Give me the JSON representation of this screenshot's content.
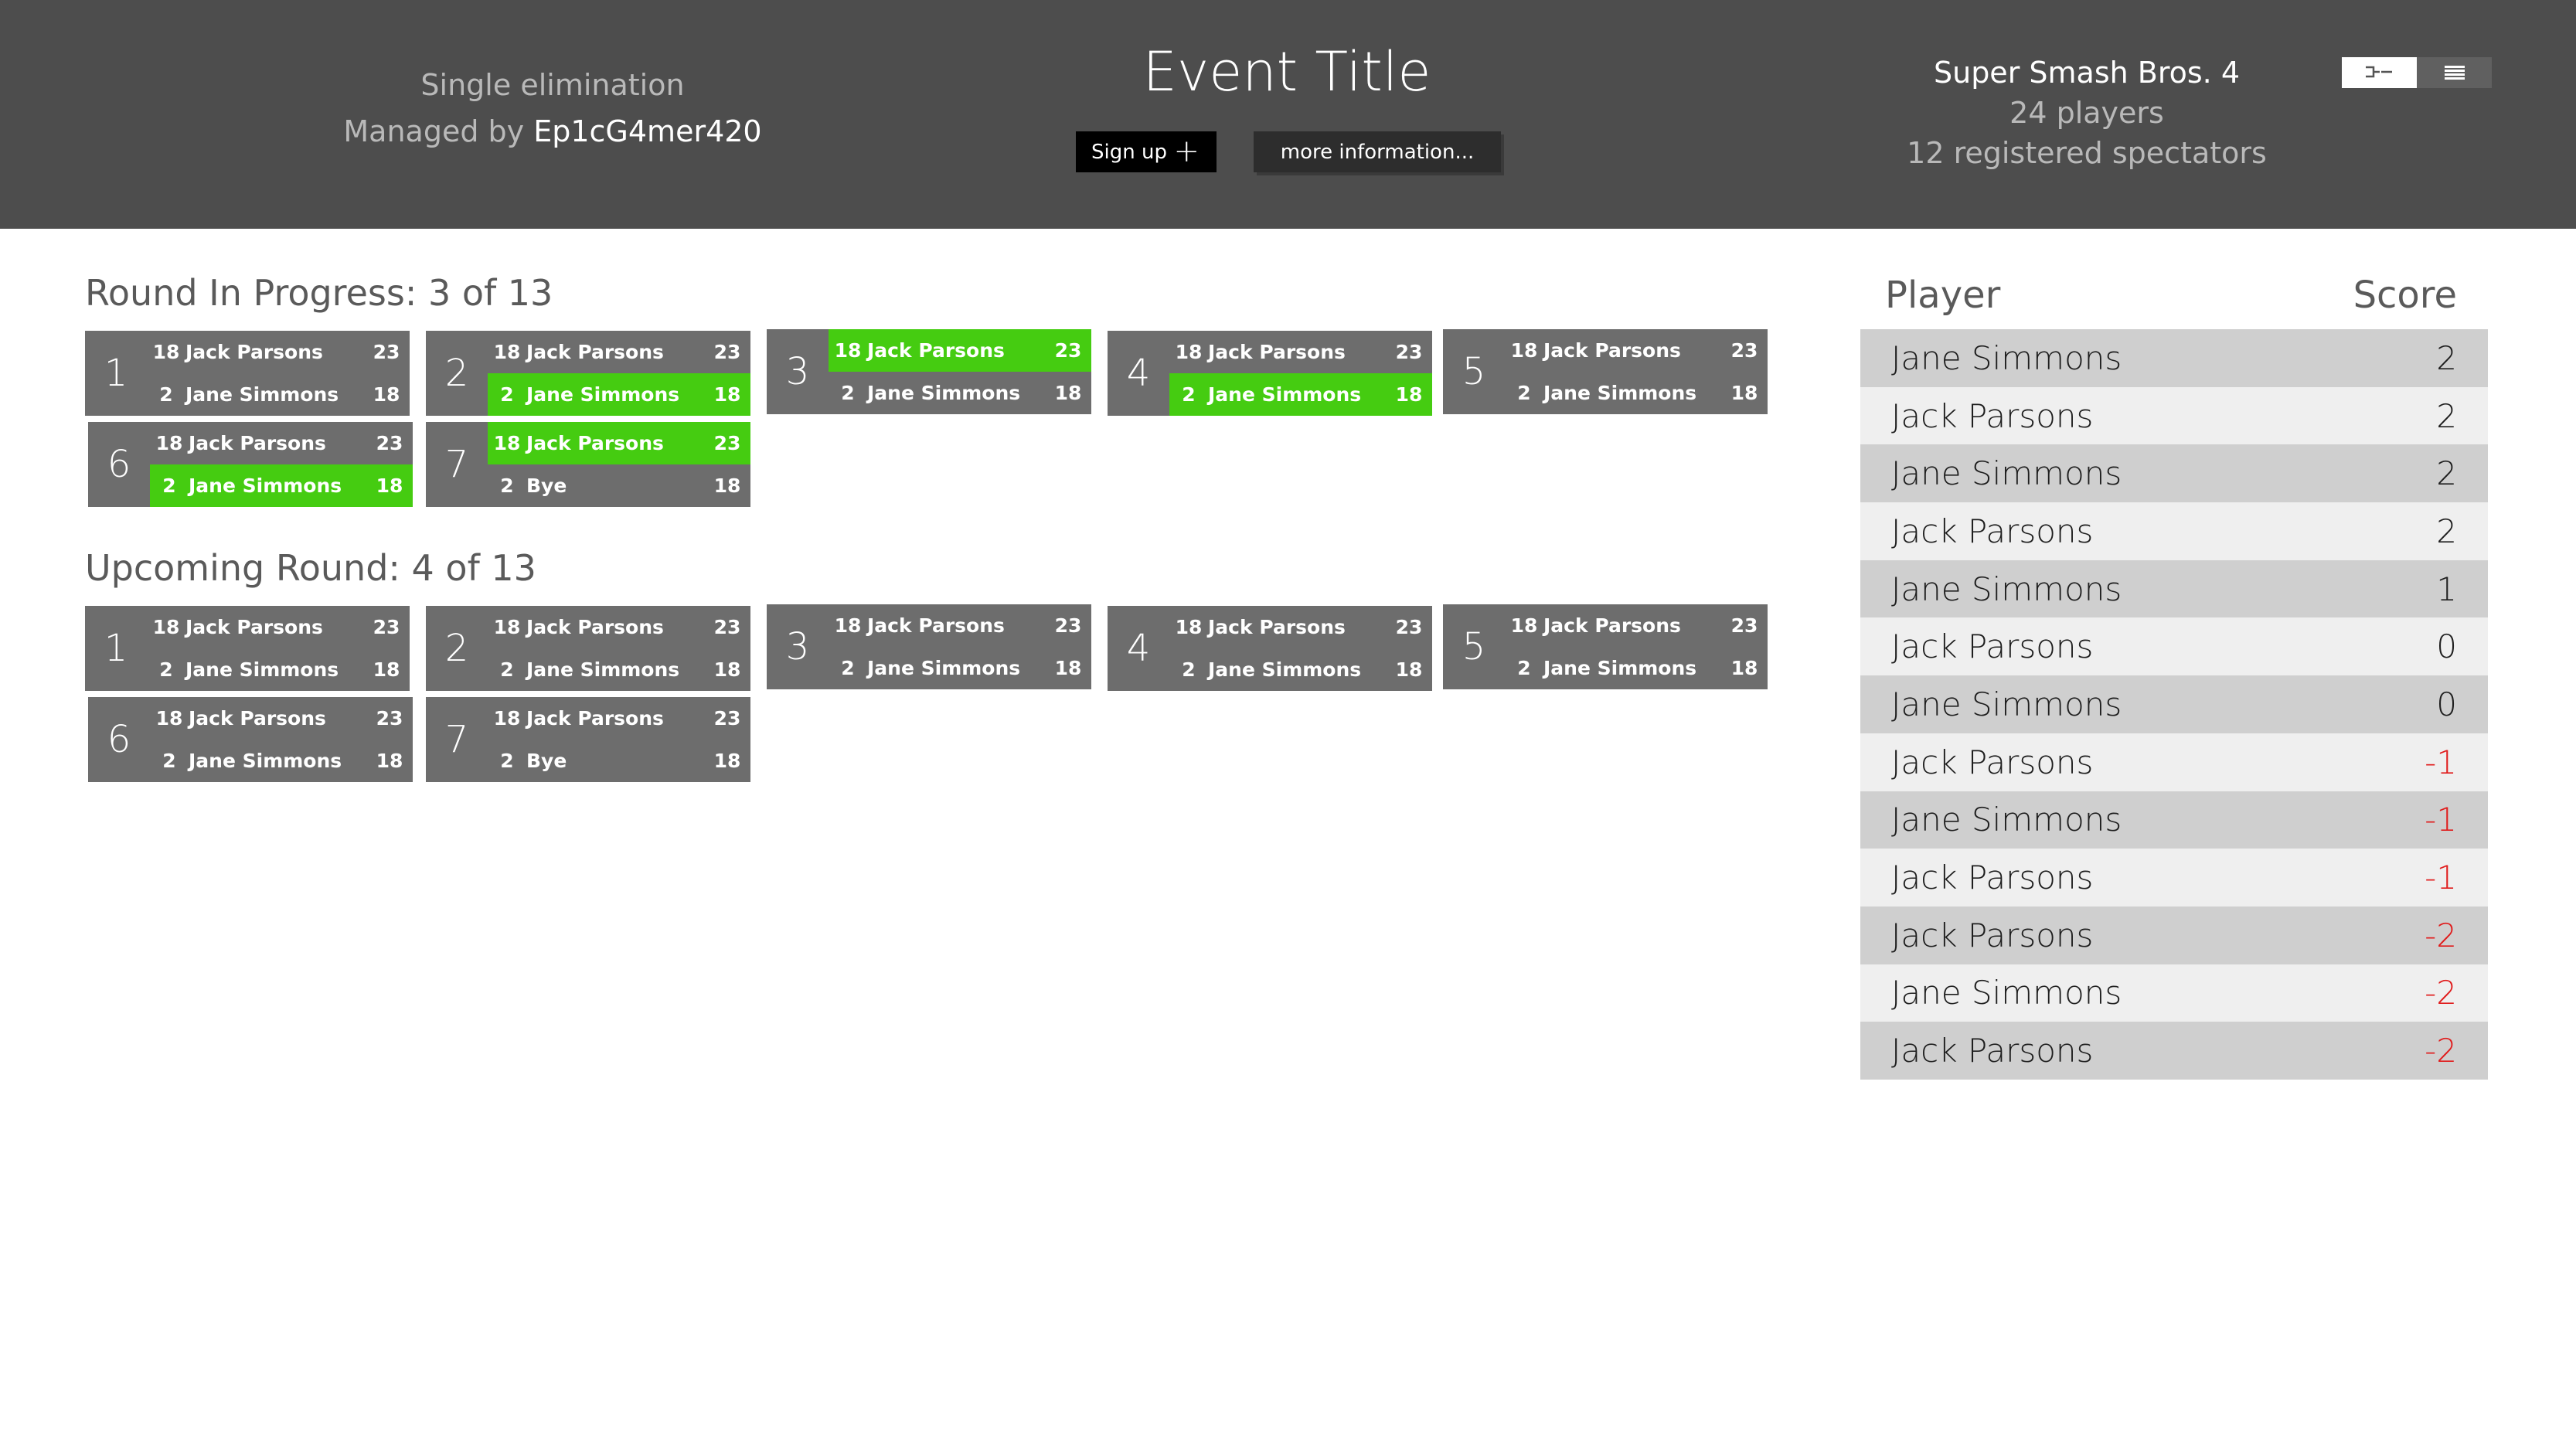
{
  "header": {
    "format": "Single elimination",
    "managed_by_label": "Managed by",
    "manager": "Ep1cG4mer420",
    "title": "Event Title",
    "signup_label": "Sign up",
    "signup_icon": "plus-icon",
    "info_label": "more information...",
    "game": "Super Smash Bros. 4",
    "players": "24 players",
    "spectators": "12 registered spectators",
    "view_toggle": [
      "bracket-view-icon",
      "list-view-icon"
    ]
  },
  "colors": {
    "header_bg": "#4d4d4d",
    "card_bg": "#6d6d6d",
    "winner": "#45cc11",
    "negative": "#e01b1b"
  },
  "current_round": {
    "title": "Round In Progress: 3 of 13",
    "matches": [
      {
        "num": "1",
        "p1": {
          "seed": "18",
          "name": "Jack Parsons",
          "score": "23"
        },
        "p2": {
          "seed": "2",
          "name": "Jane Simmons",
          "score": "18"
        },
        "winner": ""
      },
      {
        "num": "2",
        "p1": {
          "seed": "18",
          "name": "Jack Parsons",
          "score": "23"
        },
        "p2": {
          "seed": "2",
          "name": "Jane Simmons",
          "score": "18"
        },
        "winner": "p2"
      },
      {
        "num": "3",
        "p1": {
          "seed": "18",
          "name": "Jack Parsons",
          "score": "23"
        },
        "p2": {
          "seed": "2",
          "name": "Jane Simmons",
          "score": "18"
        },
        "winner": "p1"
      },
      {
        "num": "4",
        "p1": {
          "seed": "18",
          "name": "Jack Parsons",
          "score": "23"
        },
        "p2": {
          "seed": "2",
          "name": "Jane Simmons",
          "score": "18"
        },
        "winner": "p2"
      },
      {
        "num": "5",
        "p1": {
          "seed": "18",
          "name": "Jack Parsons",
          "score": "23"
        },
        "p2": {
          "seed": "2",
          "name": "Jane Simmons",
          "score": "18"
        },
        "winner": ""
      },
      {
        "num": "6",
        "p1": {
          "seed": "18",
          "name": "Jack Parsons",
          "score": "23"
        },
        "p2": {
          "seed": "2",
          "name": "Jane Simmons",
          "score": "18"
        },
        "winner": "p2"
      },
      {
        "num": "7",
        "p1": {
          "seed": "18",
          "name": "Jack Parsons",
          "score": "23"
        },
        "p2": {
          "seed": "2",
          "name": "Bye",
          "score": "18"
        },
        "winner": "p1"
      }
    ]
  },
  "upcoming_round": {
    "title": "Upcoming Round: 4 of 13",
    "matches": [
      {
        "num": "1",
        "p1": {
          "seed": "18",
          "name": "Jack Parsons",
          "score": "23"
        },
        "p2": {
          "seed": "2",
          "name": "Jane Simmons",
          "score": "18"
        },
        "winner": ""
      },
      {
        "num": "2",
        "p1": {
          "seed": "18",
          "name": "Jack Parsons",
          "score": "23"
        },
        "p2": {
          "seed": "2",
          "name": "Jane Simmons",
          "score": "18"
        },
        "winner": ""
      },
      {
        "num": "3",
        "p1": {
          "seed": "18",
          "name": "Jack Parsons",
          "score": "23"
        },
        "p2": {
          "seed": "2",
          "name": "Jane Simmons",
          "score": "18"
        },
        "winner": ""
      },
      {
        "num": "4",
        "p1": {
          "seed": "18",
          "name": "Jack Parsons",
          "score": "23"
        },
        "p2": {
          "seed": "2",
          "name": "Jane Simmons",
          "score": "18"
        },
        "winner": ""
      },
      {
        "num": "5",
        "p1": {
          "seed": "18",
          "name": "Jack Parsons",
          "score": "23"
        },
        "p2": {
          "seed": "2",
          "name": "Jane Simmons",
          "score": "18"
        },
        "winner": ""
      },
      {
        "num": "6",
        "p1": {
          "seed": "18",
          "name": "Jack Parsons",
          "score": "23"
        },
        "p2": {
          "seed": "2",
          "name": "Jane Simmons",
          "score": "18"
        },
        "winner": ""
      },
      {
        "num": "7",
        "p1": {
          "seed": "18",
          "name": "Jack Parsons",
          "score": "23"
        },
        "p2": {
          "seed": "2",
          "name": "Bye",
          "score": "18"
        },
        "winner": ""
      }
    ]
  },
  "standings": {
    "col_player": "Player",
    "col_score": "Score",
    "rows": [
      {
        "name": "Jane Simmons",
        "score": "2"
      },
      {
        "name": "Jack Parsons",
        "score": "2"
      },
      {
        "name": "Jane Simmons",
        "score": "2"
      },
      {
        "name": "Jack Parsons",
        "score": "2"
      },
      {
        "name": "Jane Simmons",
        "score": "1"
      },
      {
        "name": "Jack Parsons",
        "score": "0"
      },
      {
        "name": "Jane Simmons",
        "score": "0"
      },
      {
        "name": "Jack Parsons",
        "score": "-1"
      },
      {
        "name": "Jane Simmons",
        "score": "-1"
      },
      {
        "name": "Jack Parsons",
        "score": "-1"
      },
      {
        "name": "Jack Parsons",
        "score": "-2"
      },
      {
        "name": "Jane Simmons",
        "score": "-2"
      },
      {
        "name": "Jack Parsons",
        "score": "-2"
      }
    ]
  }
}
